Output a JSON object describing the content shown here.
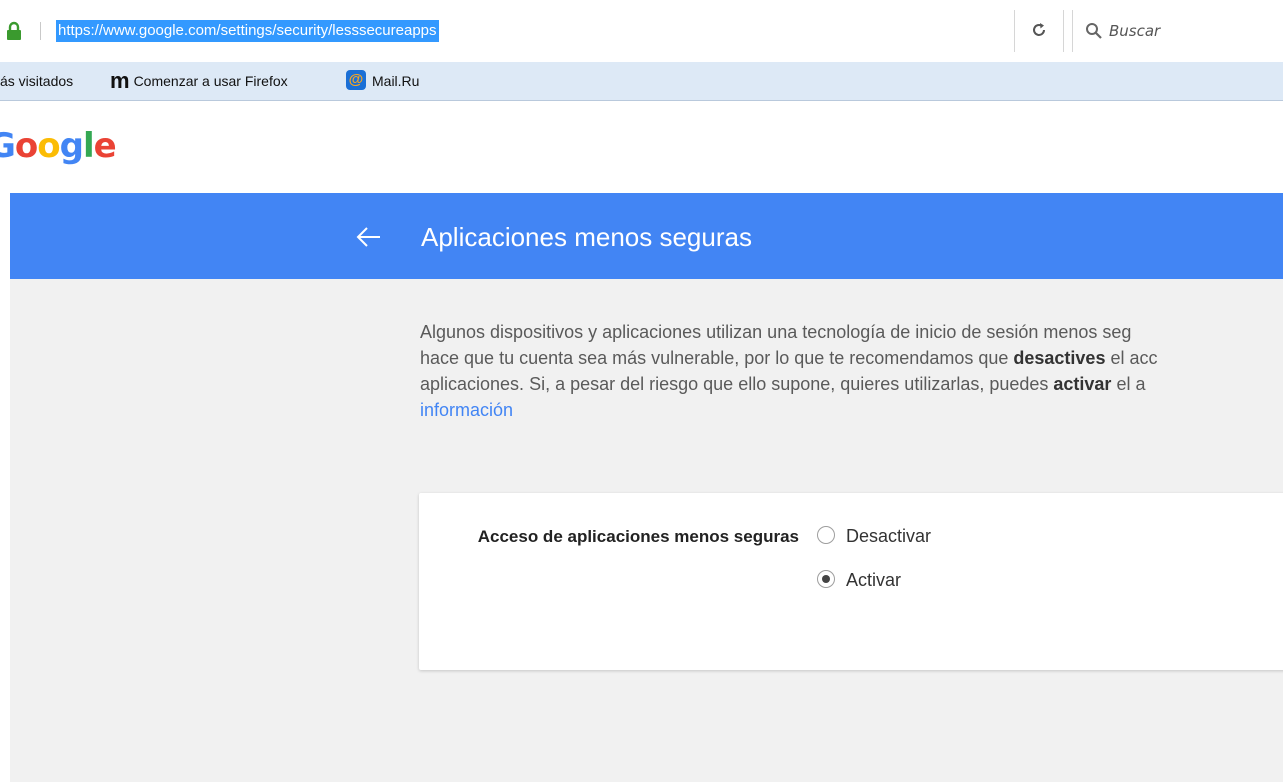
{
  "browser": {
    "url": "https://www.google.com/settings/security/lesssecureapps",
    "search_placeholder": "Buscar",
    "bookmarks": [
      {
        "label": "ás visitados",
        "icon": "none"
      },
      {
        "label": "Comenzar a usar Firefox",
        "icon": "m-logo-icon"
      },
      {
        "label": "Mail.Ru",
        "icon": "mail-ru-icon"
      }
    ]
  },
  "logo": {
    "text": "Google",
    "colors": [
      "#4285f4",
      "#ea4335",
      "#fbbc05",
      "#4285f4",
      "#34a853",
      "#ea4335"
    ]
  },
  "header": {
    "title": "Aplicaciones menos seguras",
    "background": "#4285f4"
  },
  "description": {
    "line1": "Algunos dispositivos y aplicaciones utilizan una tecnología de inicio de sesión menos seg",
    "line2_pre": "hace que tu cuenta sea más vulnerable, por lo que te recomendamos que ",
    "line2_bold": "desactives",
    "line2_post": " el acc",
    "line3_pre": "aplicaciones. Si, a pesar del riesgo que ello supone, quieres utilizarlas, puedes ",
    "line3_bold": "activar",
    "line3_post": " el a",
    "link": "información"
  },
  "setting": {
    "label": "Acceso de aplicaciones menos seguras",
    "options": [
      {
        "label": "Desactivar",
        "checked": false
      },
      {
        "label": "Activar",
        "checked": true
      }
    ]
  }
}
